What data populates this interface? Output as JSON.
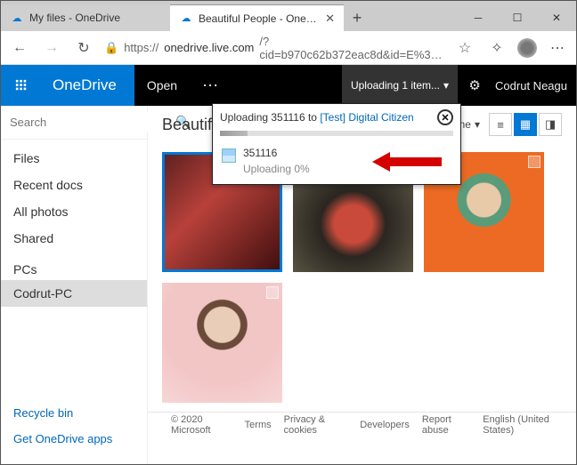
{
  "tabs": [
    {
      "label": "My files - OneDrive",
      "icon": "☁"
    },
    {
      "label": "Beautiful People - OneDrive",
      "icon": "☁"
    }
  ],
  "url": {
    "scheme": "https://",
    "host": "onedrive.live.com",
    "path": "/?cid=b970c62b372eac8d&id=E%3…"
  },
  "brand": "OneDrive",
  "commands": {
    "open": "Open"
  },
  "status": {
    "uploading": "Uploading 1 item..."
  },
  "user": "Codrut Neagu",
  "sidebar": {
    "search_placeholder": "Search",
    "items": [
      "Files",
      "Recent docs",
      "All photos",
      "Shared"
    ],
    "pcs_label": "PCs",
    "pcs": [
      "Codrut-PC"
    ],
    "bottom": [
      "Recycle bin",
      "Get OneDrive apps"
    ]
  },
  "content": {
    "title": "Beautiful P",
    "sort_label": "Name",
    "view": "grid"
  },
  "popup": {
    "prefix": "Uploading 351116 to ",
    "target": "[Test] Digital Citizen",
    "file": "351116",
    "status": "Uploading 0%"
  },
  "footer": {
    "copyright": "© 2020 Microsoft",
    "links": [
      "Terms",
      "Privacy & cookies",
      "Developers",
      "Report abuse",
      "English (United States)"
    ]
  }
}
